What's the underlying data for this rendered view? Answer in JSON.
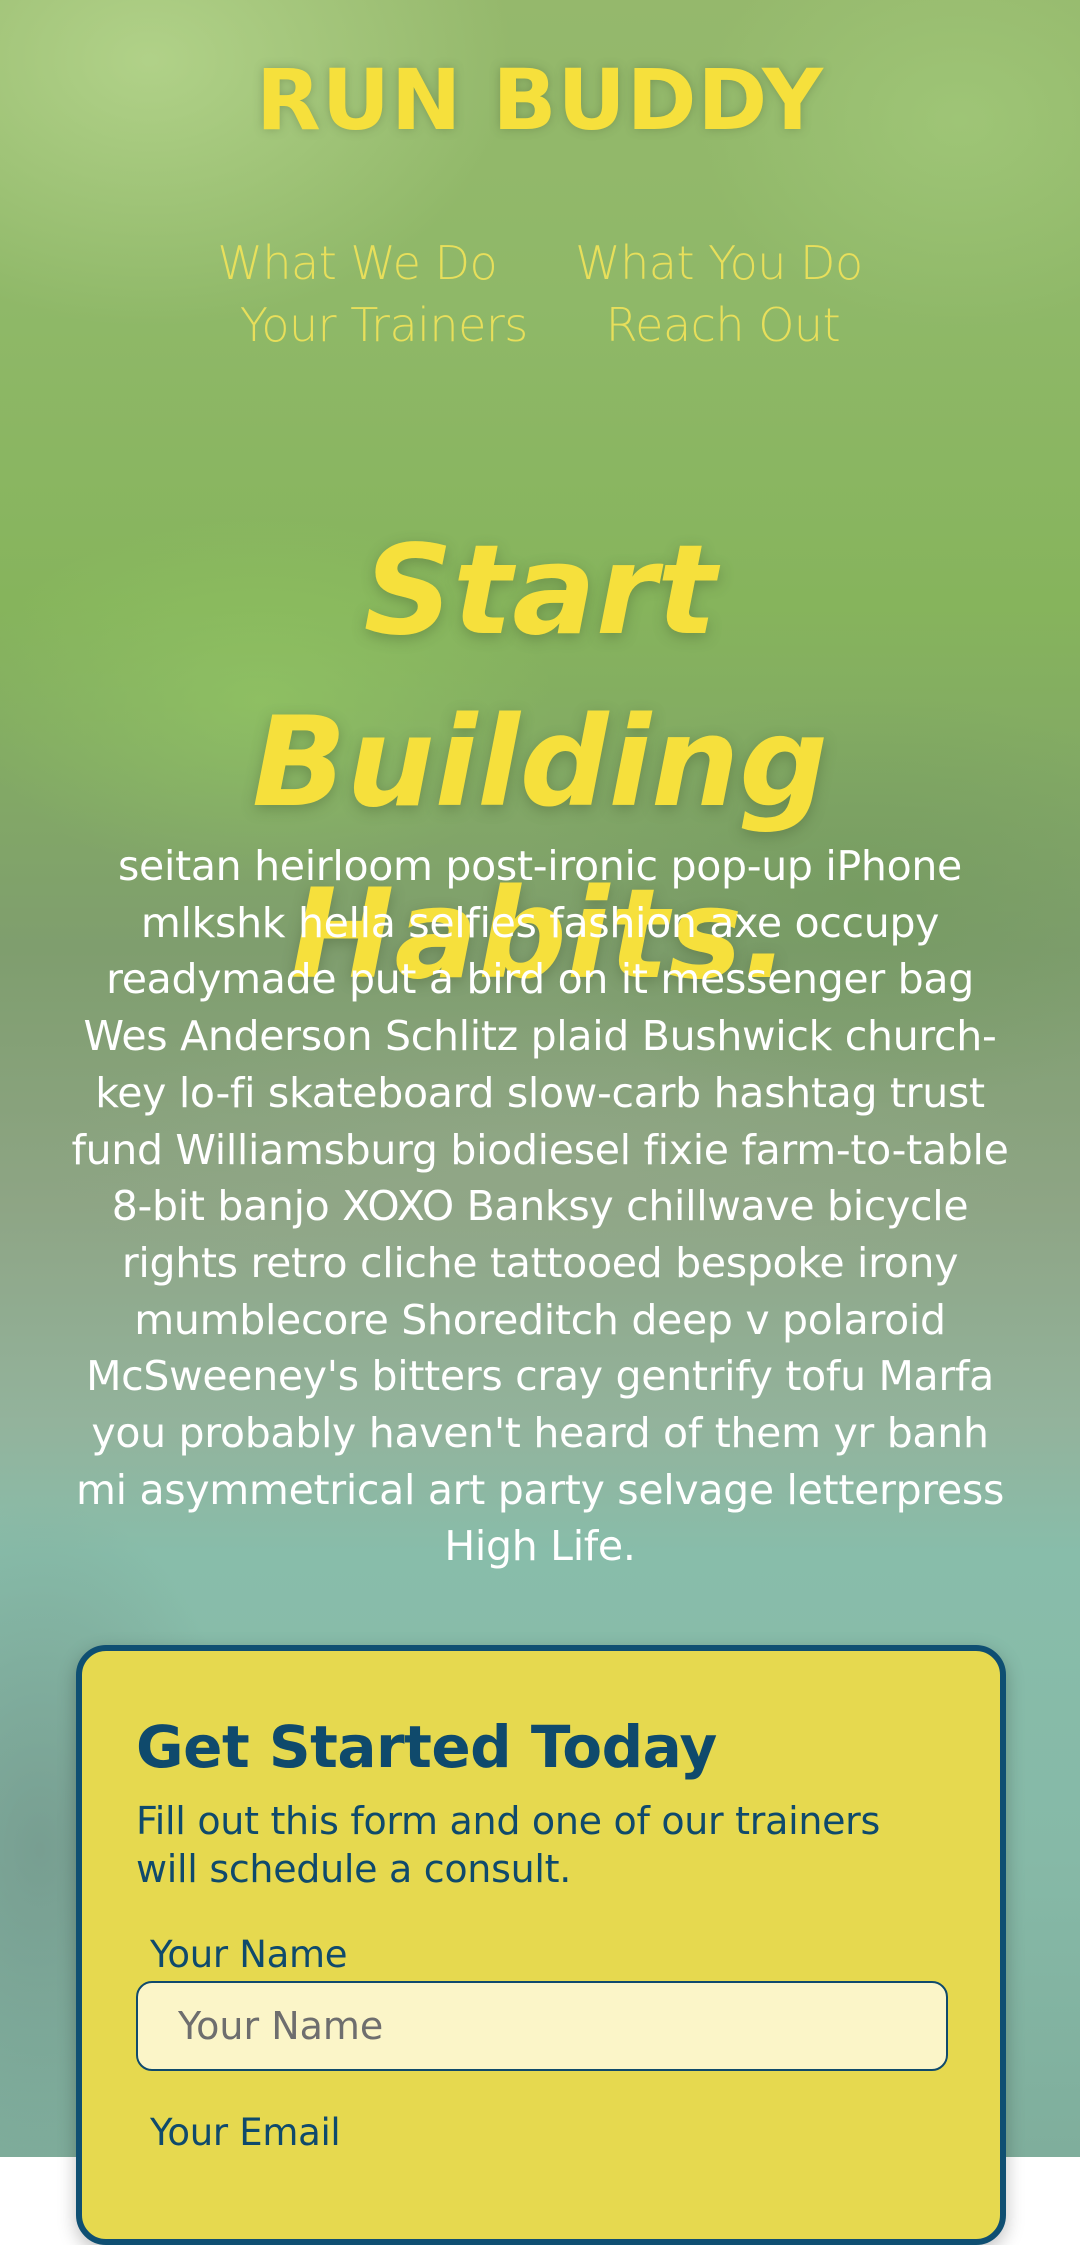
{
  "header": {
    "brand": "RUN BUDDY",
    "nav": [
      {
        "label": "What We Do"
      },
      {
        "label": "What You Do"
      },
      {
        "label": "Your Trainers"
      },
      {
        "label": "Reach Out"
      }
    ]
  },
  "hero": {
    "title_line1": "Start Building",
    "title_line2": "Habits.",
    "body": "seitan heirloom post-ironic pop-up iPhone mlkshk hella selfies fashion axe occupy readymade put a bird on it messenger bag Wes Anderson Schlitz plaid Bushwick church-key lo-fi skateboard slow-carb hashtag trust fund Williamsburg biodiesel fixie farm-to-table 8-bit banjo XOXO Banksy chillwave bicycle rights retro cliche tattooed bespoke irony mumblecore Shoreditch deep v polaroid McSweeney's bitters cray gentrify tofu Marfa you probably haven't heard of them yr banh mi asymmetrical art party selvage letterpress High Life."
  },
  "signup": {
    "title": "Get Started Today",
    "subtitle": "Fill out this form and one of our trainers will schedule a consult.",
    "name_label": "Your Name",
    "name_placeholder": "Your Name",
    "name_value": "",
    "email_label": "Your Email"
  },
  "colors": {
    "accent_yellow": "#f6e03c",
    "card_yellow": "#e6d94f",
    "navy": "#0f4a6c",
    "input_bg": "#fbf5c8"
  }
}
